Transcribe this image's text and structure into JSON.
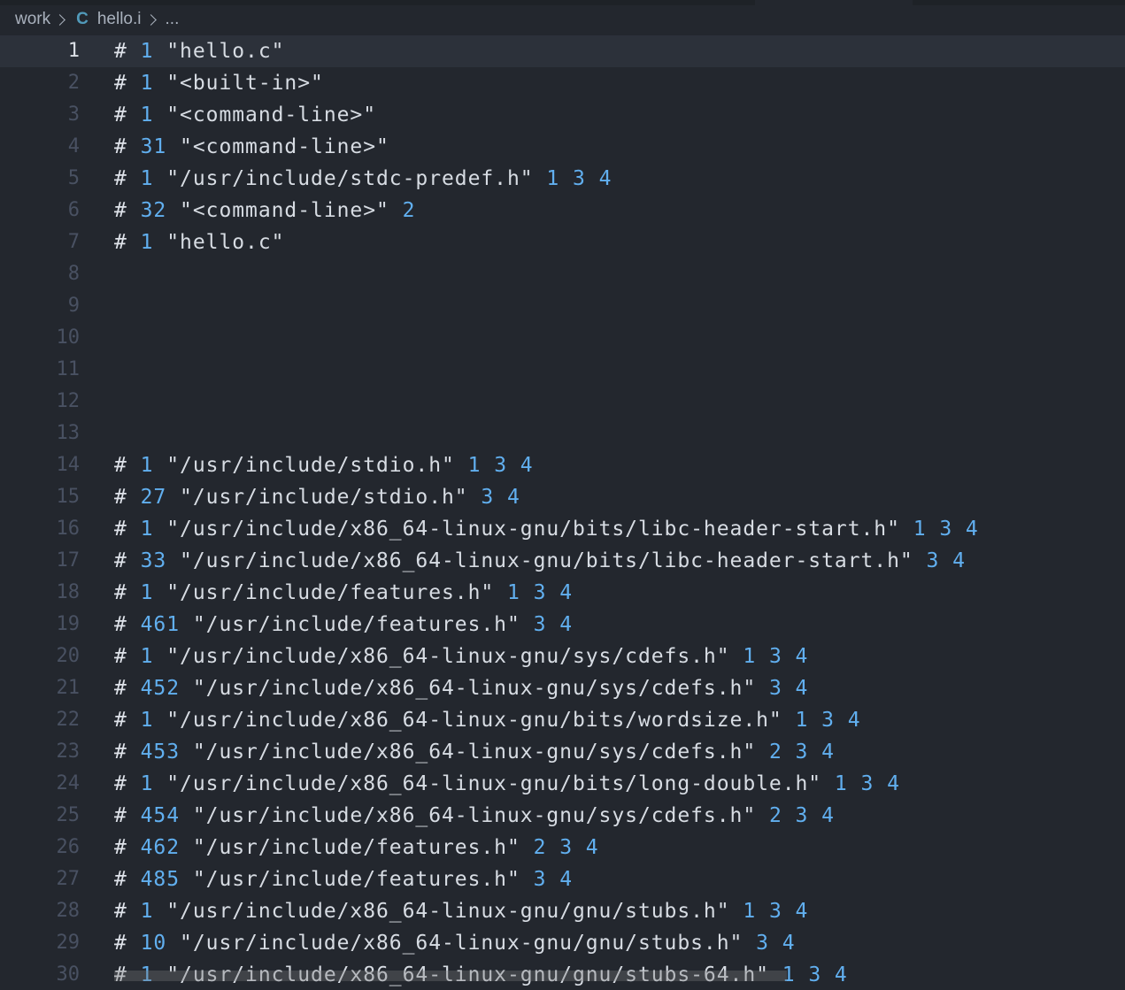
{
  "breadcrumb": {
    "folder": "work",
    "file_icon": "C",
    "file": "hello.i",
    "more": "..."
  },
  "icons": {
    "file_icon": "c-language-icon",
    "separator": "chevron-right-icon"
  },
  "colors": {
    "background": "#23272e",
    "line_highlight": "#2c313a",
    "number": "#61afef",
    "string": "#d7dce3",
    "gutter": "#495162",
    "c_icon": "#519aba"
  },
  "editor": {
    "current_line": 1,
    "lines": [
      {
        "n": "1",
        "hash": "#",
        "num": "1",
        "str": "\"hello.c\"",
        "flags": ""
      },
      {
        "n": "2",
        "hash": "#",
        "num": "1",
        "str": "\"<built-in>\"",
        "flags": ""
      },
      {
        "n": "3",
        "hash": "#",
        "num": "1",
        "str": "\"<command-line>\"",
        "flags": ""
      },
      {
        "n": "4",
        "hash": "#",
        "num": "31",
        "str": "\"<command-line>\"",
        "flags": ""
      },
      {
        "n": "5",
        "hash": "#",
        "num": "1",
        "str": "\"/usr/include/stdc-predef.h\"",
        "flags": "1 3 4"
      },
      {
        "n": "6",
        "hash": "#",
        "num": "32",
        "str": "\"<command-line>\"",
        "flags": "2"
      },
      {
        "n": "7",
        "hash": "#",
        "num": "1",
        "str": "\"hello.c\"",
        "flags": ""
      },
      {
        "n": "8",
        "hash": "",
        "num": "",
        "str": "",
        "flags": ""
      },
      {
        "n": "9",
        "hash": "",
        "num": "",
        "str": "",
        "flags": ""
      },
      {
        "n": "10",
        "hash": "",
        "num": "",
        "str": "",
        "flags": ""
      },
      {
        "n": "11",
        "hash": "",
        "num": "",
        "str": "",
        "flags": ""
      },
      {
        "n": "12",
        "hash": "",
        "num": "",
        "str": "",
        "flags": ""
      },
      {
        "n": "13",
        "hash": "",
        "num": "",
        "str": "",
        "flags": ""
      },
      {
        "n": "14",
        "hash": "#",
        "num": "1",
        "str": "\"/usr/include/stdio.h\"",
        "flags": "1 3 4"
      },
      {
        "n": "15",
        "hash": "#",
        "num": "27",
        "str": "\"/usr/include/stdio.h\"",
        "flags": "3 4"
      },
      {
        "n": "16",
        "hash": "#",
        "num": "1",
        "str": "\"/usr/include/x86_64-linux-gnu/bits/libc-header-start.h\"",
        "flags": "1 3 4"
      },
      {
        "n": "17",
        "hash": "#",
        "num": "33",
        "str": "\"/usr/include/x86_64-linux-gnu/bits/libc-header-start.h\"",
        "flags": "3 4"
      },
      {
        "n": "18",
        "hash": "#",
        "num": "1",
        "str": "\"/usr/include/features.h\"",
        "flags": "1 3 4"
      },
      {
        "n": "19",
        "hash": "#",
        "num": "461",
        "str": "\"/usr/include/features.h\"",
        "flags": "3 4"
      },
      {
        "n": "20",
        "hash": "#",
        "num": "1",
        "str": "\"/usr/include/x86_64-linux-gnu/sys/cdefs.h\"",
        "flags": "1 3 4"
      },
      {
        "n": "21",
        "hash": "#",
        "num": "452",
        "str": "\"/usr/include/x86_64-linux-gnu/sys/cdefs.h\"",
        "flags": "3 4"
      },
      {
        "n": "22",
        "hash": "#",
        "num": "1",
        "str": "\"/usr/include/x86_64-linux-gnu/bits/wordsize.h\"",
        "flags": "1 3 4"
      },
      {
        "n": "23",
        "hash": "#",
        "num": "453",
        "str": "\"/usr/include/x86_64-linux-gnu/sys/cdefs.h\"",
        "flags": "2 3 4"
      },
      {
        "n": "24",
        "hash": "#",
        "num": "1",
        "str": "\"/usr/include/x86_64-linux-gnu/bits/long-double.h\"",
        "flags": "1 3 4"
      },
      {
        "n": "25",
        "hash": "#",
        "num": "454",
        "str": "\"/usr/include/x86_64-linux-gnu/sys/cdefs.h\"",
        "flags": "2 3 4"
      },
      {
        "n": "26",
        "hash": "#",
        "num": "462",
        "str": "\"/usr/include/features.h\"",
        "flags": "2 3 4"
      },
      {
        "n": "27",
        "hash": "#",
        "num": "485",
        "str": "\"/usr/include/features.h\"",
        "flags": "3 4"
      },
      {
        "n": "28",
        "hash": "#",
        "num": "1",
        "str": "\"/usr/include/x86_64-linux-gnu/gnu/stubs.h\"",
        "flags": "1 3 4"
      },
      {
        "n": "29",
        "hash": "#",
        "num": "10",
        "str": "\"/usr/include/x86_64-linux-gnu/gnu/stubs.h\"",
        "flags": "3 4"
      },
      {
        "n": "30",
        "hash": "#",
        "num": "1",
        "str": "\"/usr/include/x86_64-linux-gnu/gnu/stubs-64.h\"",
        "flags": "1 3 4"
      }
    ]
  }
}
